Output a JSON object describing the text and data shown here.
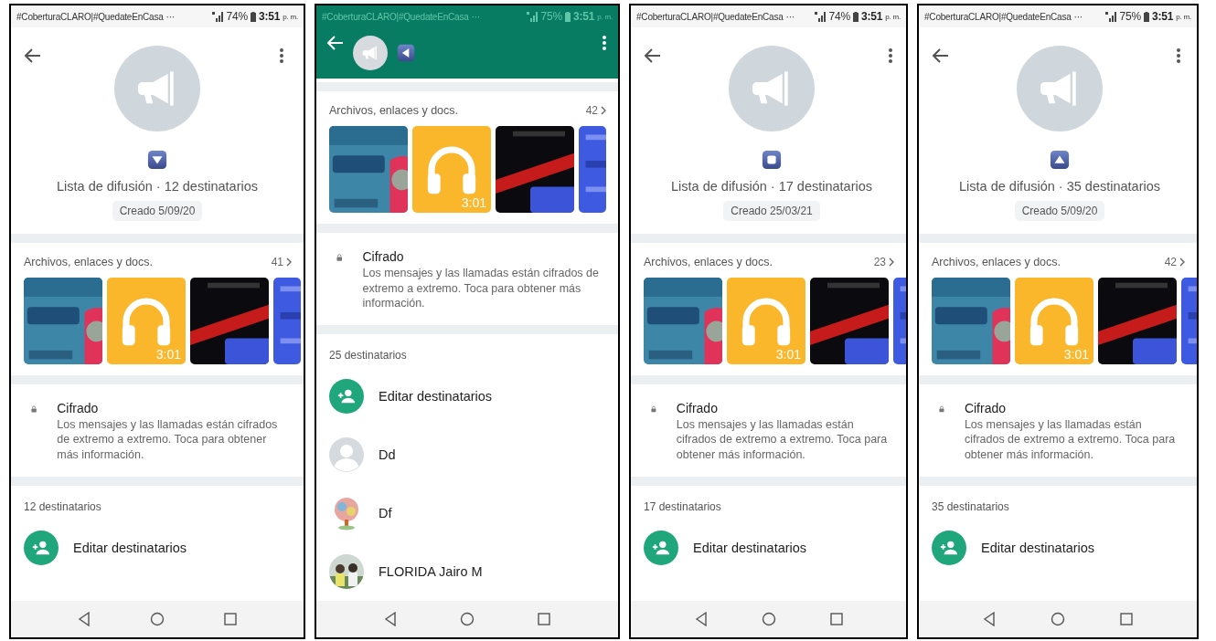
{
  "phones": [
    {
      "kind": "profile",
      "status_bar": {
        "notification": "#CoberturaCLARO|#QuedateEnCasa",
        "more": "···",
        "battery": "74%",
        "time": "3:51",
        "period": "p. m."
      },
      "badge": {
        "kind": "down"
      },
      "title": "Lista de difusión · 12 destinatarios",
      "created": "Creado 5/09/20",
      "media": {
        "label": "Archivos, enlaces y docs.",
        "count": "41",
        "items": [
          {
            "kind": "picture"
          },
          {
            "kind": "audio",
            "duration": "3:01"
          },
          {
            "kind": "picture"
          },
          {
            "kind": "picture"
          }
        ]
      },
      "encryption": {
        "title": "Cifrado",
        "text": "Los mensajes y las llamadas están cifrados de extremo a extremo. Toca para obtener más información."
      },
      "recipients": {
        "count_label": "12 destinatarios",
        "edit_label": "Editar destinatarios"
      }
    },
    {
      "kind": "scrolled",
      "status_bar": {
        "notification": "#CoberturaCLARO|#QuedateEnCasa",
        "more": "···",
        "battery": "75%",
        "time": "3:51",
        "period": "p. m."
      },
      "badge": {
        "kind": "left"
      },
      "media": {
        "label": "Archivos, enlaces y docs.",
        "count": "42",
        "items": [
          {
            "kind": "picture"
          },
          {
            "kind": "audio",
            "duration": "3:01"
          },
          {
            "kind": "picture"
          },
          {
            "kind": "picture"
          }
        ]
      },
      "encryption": {
        "title": "Cifrado",
        "text": "Los mensajes y las llamadas están cifrados de extremo a extremo. Toca para obtener más información."
      },
      "recipients": {
        "count_label": "25 destinatarios",
        "edit_label": "Editar destinatarios",
        "contacts": [
          {
            "name": "Dd",
            "kind": "default"
          },
          {
            "name": "Df",
            "kind": "picture"
          },
          {
            "name": "FLORIDA Jairo M",
            "kind": "picture"
          }
        ]
      }
    },
    {
      "kind": "profile",
      "status_bar": {
        "notification": "#CoberturaCLARO|#QuedateEnCasa",
        "more": "···",
        "battery": "74%",
        "time": "3:51",
        "period": "p. m."
      },
      "badge": {
        "kind": "square"
      },
      "title": "Lista de difusión · 17 destinatarios",
      "created": "Creado 25/03/21",
      "media": {
        "label": "Archivos, enlaces y docs.",
        "count": "23",
        "items": [
          {
            "kind": "picture"
          },
          {
            "kind": "audio",
            "duration": "3:01"
          },
          {
            "kind": "picture"
          },
          {
            "kind": "picture"
          }
        ]
      },
      "encryption": {
        "title": "Cifrado",
        "text": "Los mensajes y las llamadas están cifrados de extremo a extremo. Toca para obtener más información."
      },
      "recipients": {
        "count_label": "17 destinatarios",
        "edit_label": "Editar destinatarios"
      }
    },
    {
      "kind": "profile",
      "status_bar": {
        "notification": "#CoberturaCLARO|#QuedateEnCasa",
        "more": "···",
        "battery": "75%",
        "time": "3:51",
        "period": "p. m."
      },
      "badge": {
        "kind": "up"
      },
      "title": "Lista de difusión · 35 destinatarios",
      "created": "Creado 5/09/20",
      "media": {
        "label": "Archivos, enlaces y docs.",
        "count": "42",
        "items": [
          {
            "kind": "picture"
          },
          {
            "kind": "audio",
            "duration": "3:01"
          },
          {
            "kind": "picture"
          },
          {
            "kind": "picture"
          }
        ]
      },
      "encryption": {
        "title": "Cifrado",
        "text": "Los mensajes y las llamadas están cifrados de extremo a extremo. Toca para obtener más información."
      },
      "recipients": {
        "count_label": "35 destinatarios",
        "edit_label": "Editar destinatarios"
      }
    }
  ]
}
